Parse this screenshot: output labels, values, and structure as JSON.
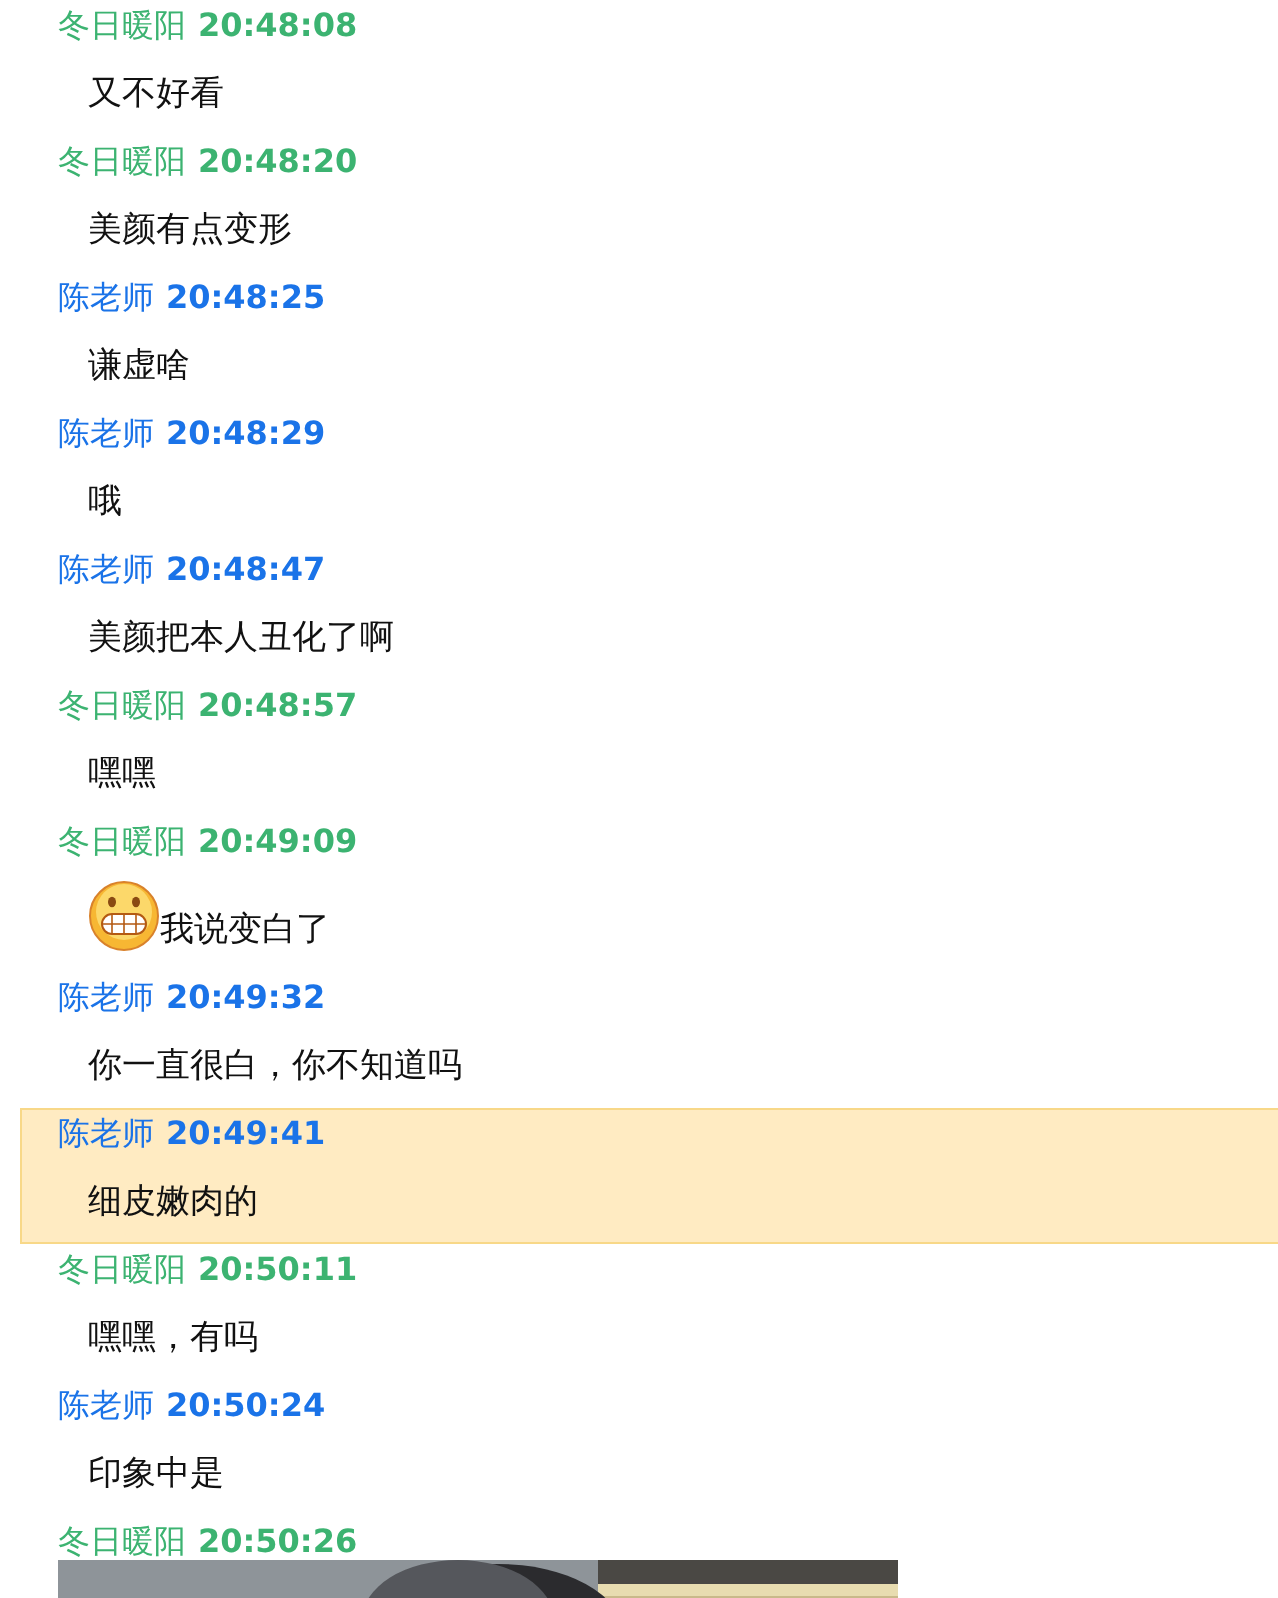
{
  "messages": [
    {
      "sender": "冬日暖阳",
      "time": "20:48:08",
      "color": "#3cb371",
      "selected": false,
      "kind": "text",
      "text": "又不好看"
    },
    {
      "sender": "冬日暖阳",
      "time": "20:48:20",
      "color": "#3cb371",
      "selected": false,
      "kind": "text",
      "text": "美颜有点变形"
    },
    {
      "sender": "陈老师",
      "time": "20:48:25",
      "color": "#1a73e8",
      "selected": false,
      "kind": "text",
      "text": "谦虚啥"
    },
    {
      "sender": "陈老师",
      "time": "20:48:29",
      "color": "#1a73e8",
      "selected": false,
      "kind": "text",
      "text": "哦"
    },
    {
      "sender": "陈老师",
      "time": "20:48:47",
      "color": "#1a73e8",
      "selected": false,
      "kind": "text",
      "text": "美颜把本人丑化了啊"
    },
    {
      "sender": "冬日暖阳",
      "time": "20:48:57",
      "color": "#3cb371",
      "selected": false,
      "kind": "text",
      "text": "嘿嘿"
    },
    {
      "sender": "冬日暖阳",
      "time": "20:49:09",
      "color": "#3cb371",
      "selected": false,
      "kind": "emoji_text",
      "text": "我说变白了"
    },
    {
      "sender": "陈老师",
      "time": "20:49:32",
      "color": "#1a73e8",
      "selected": false,
      "kind": "text",
      "text": "你一直很白，你不知道吗"
    },
    {
      "sender": "陈老师",
      "time": "20:49:41",
      "color": "#1a73e8",
      "selected": true,
      "kind": "text",
      "text": "细皮嫩肉的"
    },
    {
      "sender": "冬日暖阳",
      "time": "20:50:11",
      "color": "#3cb371",
      "selected": false,
      "kind": "text",
      "text": "嘿嘿，有吗"
    },
    {
      "sender": "陈老师",
      "time": "20:50:24",
      "color": "#1a73e8",
      "selected": false,
      "kind": "text",
      "text": "印象中是"
    },
    {
      "sender": "冬日暖阳",
      "time": "20:50:26",
      "color": "#3cb371",
      "selected": false
    }
  ]
}
